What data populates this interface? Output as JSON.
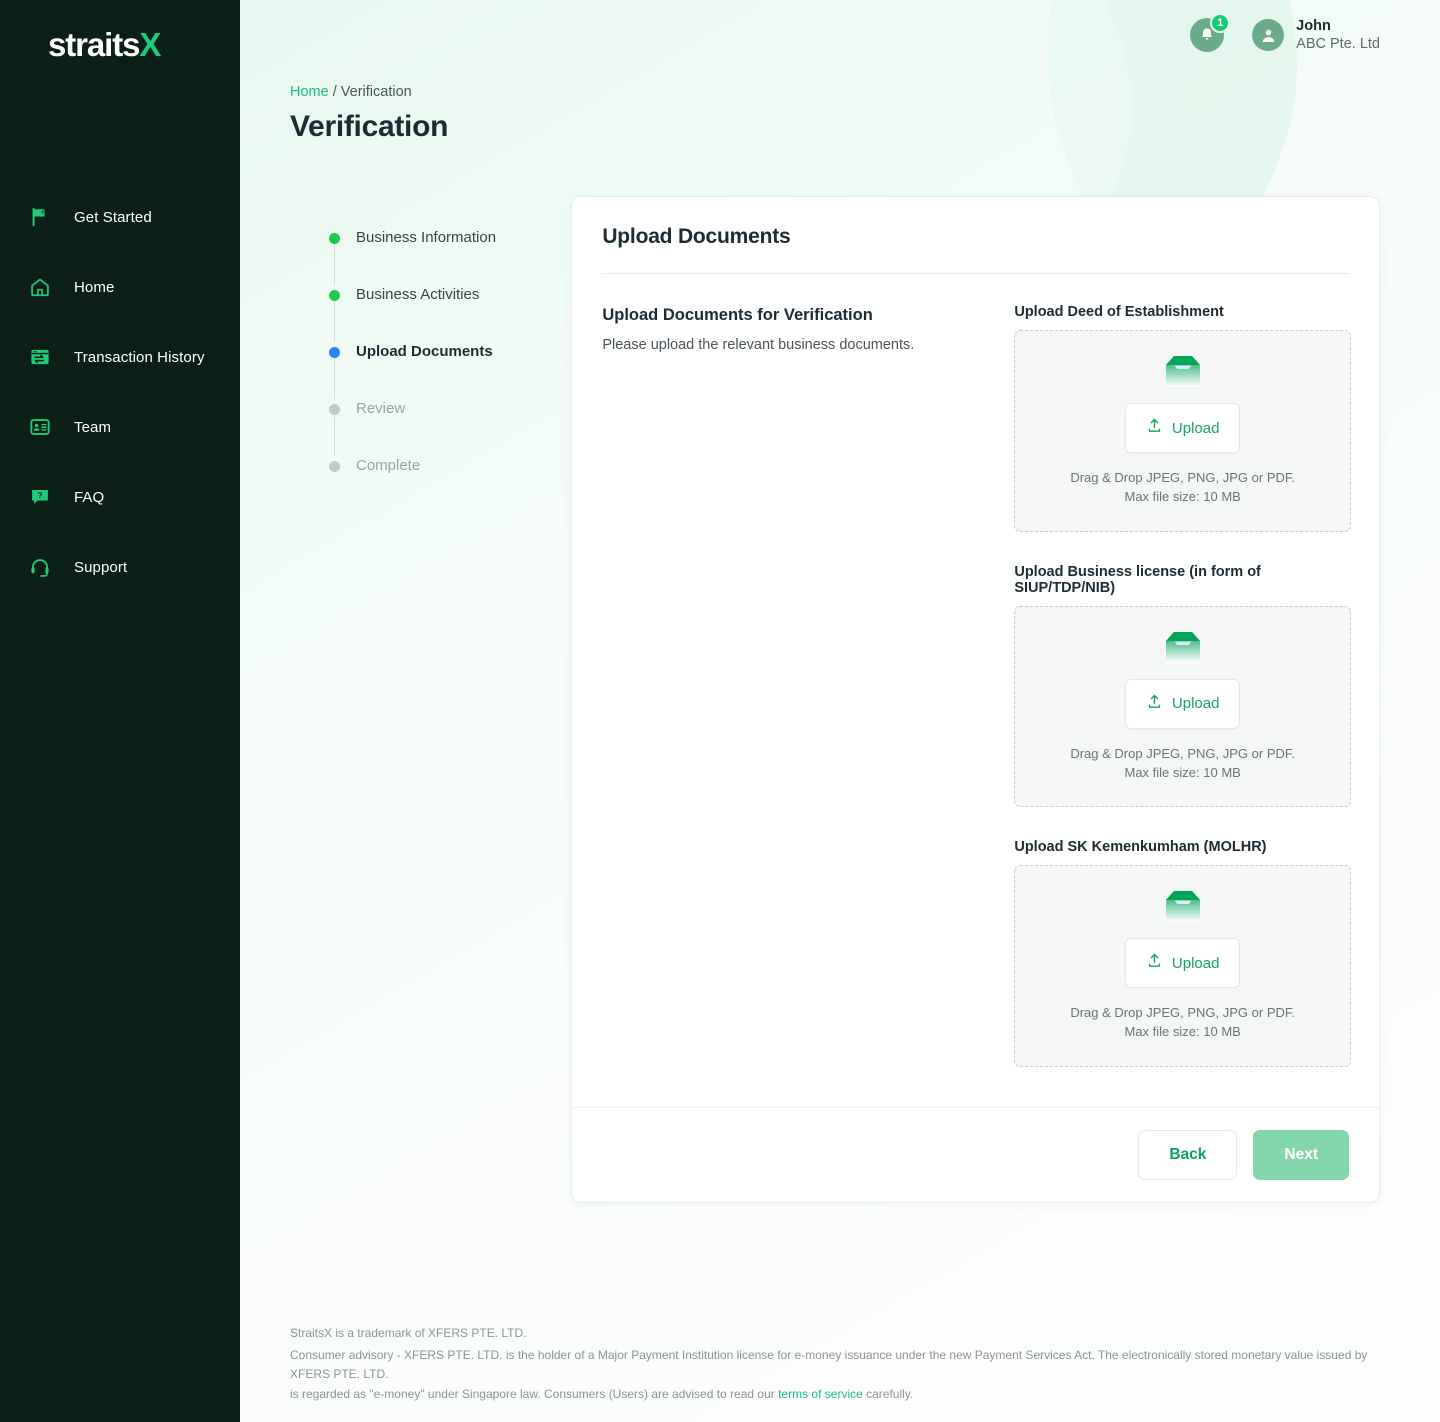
{
  "brand": {
    "name_main": "straits",
    "name_accent": "X"
  },
  "sidebar": {
    "items": [
      {
        "label": "Get Started",
        "icon": "flag-icon"
      },
      {
        "label": "Home",
        "icon": "home-icon"
      },
      {
        "label": "Transaction History",
        "icon": "transaction-history-icon"
      },
      {
        "label": "Team",
        "icon": "team-id-card-icon"
      },
      {
        "label": "FAQ",
        "icon": "faq-question-bubble-icon"
      },
      {
        "label": "Support",
        "icon": "headset-icon"
      }
    ]
  },
  "topbar": {
    "notification_count": "1",
    "user_name": "John",
    "user_org": "ABC Pte. Ltd"
  },
  "breadcrumb": {
    "home": "Home",
    "separator": "/",
    "current": "Verification"
  },
  "page": {
    "title": "Verification"
  },
  "stepper": {
    "steps": [
      {
        "label": "Business Information",
        "state": "done"
      },
      {
        "label": "Business Activities",
        "state": "done"
      },
      {
        "label": "Upload Documents",
        "state": "current"
      },
      {
        "label": "Review",
        "state": "todo"
      },
      {
        "label": "Complete",
        "state": "todo"
      }
    ]
  },
  "card": {
    "title": "Upload Documents",
    "lead_title": "Upload Documents for Verification",
    "lead_desc": "Please upload the relevant business documents.",
    "uploads": [
      {
        "label": "Upload Deed of Establishment",
        "button_label": "Upload",
        "hint_line1": "Drag & Drop JPEG, PNG, JPG or PDF.",
        "hint_line2": "Max file size: 10 MB"
      },
      {
        "label": "Upload Business license (in form of SIUP/TDP/NIB)",
        "button_label": "Upload",
        "hint_line1": "Drag & Drop JPEG, PNG, JPG or PDF.",
        "hint_line2": "Max file size: 10 MB"
      },
      {
        "label": "Upload SK Kemenkumham (MOLHR)",
        "button_label": "Upload",
        "hint_line1": "Drag & Drop JPEG, PNG, JPG or PDF.",
        "hint_line2": "Max file size: 10 MB"
      }
    ],
    "back_label": "Back",
    "next_label": "Next"
  },
  "footer": {
    "line1": "StraitsX is a trademark of XFERS PTE. LTD.",
    "line2": "Consumer advisory - XFERS PTE. LTD. is the holder of a Major Payment Institution license for e-money issuance under the new Payment Services Act. The electronically stored monetary value issued by XFERS PTE. LTD.",
    "line3_before": "is regarded as \"e-money\" under Singapore law. Consumers (Users) are advised to read our ",
    "line3_link": "terms of service",
    "line3_after": " carefully."
  },
  "colors": {
    "brand_green": "#1ecb7b",
    "sidebar_bg": "#0b1f17",
    "link_green": "#18c07a",
    "step_done": "#21c94a",
    "step_current": "#2684ff",
    "step_todo": "#c3c9cc",
    "next_disabled": "#86d6ad"
  }
}
